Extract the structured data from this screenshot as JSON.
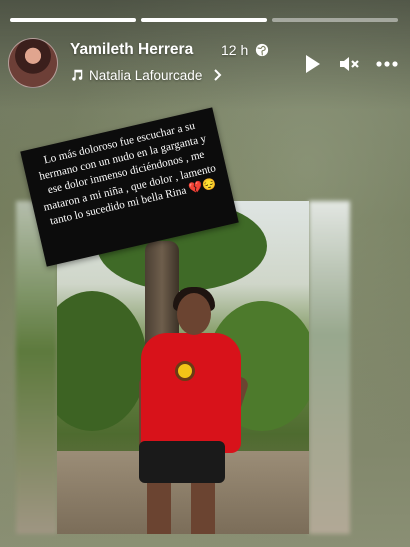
{
  "story": {
    "progress_segments": 3,
    "active_segment": 2
  },
  "header": {
    "author_name": "Yamileth Herrera",
    "time_ago": "12 h",
    "privacy_icon": "globe-icon",
    "music_label": "Natalia Lafourcade",
    "music_icon": "music-note-icon"
  },
  "controls": {
    "play_icon": "play-icon",
    "mute_icon": "volume-muted-icon",
    "more_icon": "more-options-icon"
  },
  "caption": {
    "text": "Lo más doloroso fue escuchar a su hermano con un nudo en la garganta y ese dolor inmenso diciéndonos , me mataron a mi niña , que dolor , lamento tanto lo sucedido mi bella Rina 💔😔"
  }
}
